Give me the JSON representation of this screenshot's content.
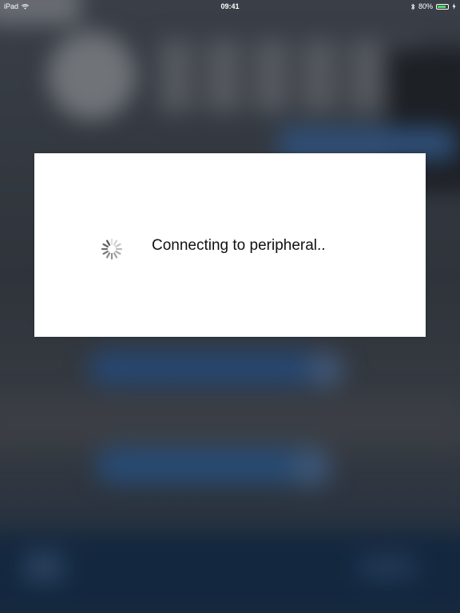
{
  "status_bar": {
    "device": "iPad",
    "time": "09:41",
    "battery_percent": "80%",
    "battery_level": 0.8,
    "wifi_icon": "wifi-icon",
    "bluetooth_icon": "bluetooth-icon",
    "charging_icon": "charging-icon"
  },
  "modal": {
    "message": "Connecting to peripheral..",
    "spinner_icon": "activity-spinner-icon"
  },
  "colors": {
    "battery_fill": "#4cd964",
    "modal_background": "#ffffff",
    "background_blue": "#27466e"
  }
}
